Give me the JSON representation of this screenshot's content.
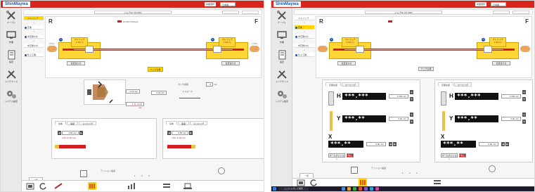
{
  "app": {
    "logo": "ShinMaywa",
    "lang_label": "言語選択",
    "lang_value": "日本語"
  },
  "shot_a": {
    "title": "ジョブNo.AN-0001",
    "sidebar": [
      "ケーブル",
      "作業",
      "設定",
      "メンテナンス",
      "システム設定"
    ],
    "steps": [
      "ストリップ",
      "圧着",
      "中芯整わせ",
      "中芯整わせ",
      "仕上工程"
    ],
    "left_letter": "R",
    "right_letter": "F",
    "left_strip": "ストリップ",
    "left_strip_val": "4.50mm",
    "right_strip": "ストリップ",
    "right_strip_val": "4.50mm",
    "pos_left": "位置合わせ",
    "pos_right": "位置合わせ",
    "mode_button": "ウェグ戻量",
    "side_labels": [
      "パネル",
      "パネル"
    ],
    "wire_info": "UL1007 AWG24",
    "center_values": [
      "1.41 mm",
      "0.10 mm",
      "1.41 +0.00 mm"
    ],
    "slider_label": "センサ感度",
    "slider_value": "0",
    "slider_unit": "mm",
    "counter_label": "ストローク",
    "tabs_left": [
      "基本",
      "速度",
      "トリミング"
    ],
    "tabs_right": [
      "基本",
      "速度",
      "トリミング"
    ],
    "strip_left_val": "4.50 mm",
    "strip_left_sub": "4.50 +0.00 mm",
    "strip_right_val": "4.50 mm",
    "strip_right_sub": "4.50 +0.00 mm",
    "bottom_label": "一覧",
    "speed_label": "テンション速度",
    "speed_scale": [
      "1",
      "2",
      "3"
    ]
  },
  "shot_b": {
    "title": "ジョブNo.AN-0001",
    "sidebar": [
      "ケーブル",
      "作業",
      "設定",
      "メンテナンス",
      "システム設定"
    ],
    "steps": [
      "ストリップ",
      "圧着",
      "中芯整わせ",
      "中芯整わせ",
      "仕上工程"
    ],
    "left_letter": "R",
    "right_letter": "F",
    "left_strip": "ストリップ",
    "left_strip_val": "4.50mm",
    "right_strip": "ストリップ",
    "right_strip_val": "4.50mm",
    "pos_left": "位置合わせ",
    "pos_right": "位置合わせ",
    "mode_button": "ウェグ戻量",
    "tabs_left": [
      "圧着位置",
      "ワーピング"
    ],
    "tabs_right": [
      "圧着位置",
      "ワーピング"
    ],
    "h_display": "***.***",
    "h_value": "2.000 mm",
    "y_display": "***.**",
    "y_value": "0.00 mm",
    "x_display": "***.**",
    "x_value": "0.00 mm",
    "reset_label": "ホームポジション",
    "stop_label": "停止",
    "bottom_label": "一覧",
    "speed_label": "テンション速度",
    "speed_scale": [
      "1",
      "2",
      "3"
    ],
    "taskbar_search": "ここに入力して検索"
  },
  "colors": {
    "brand_red": "#d9261c",
    "accent_yellow": "#ffd633",
    "wire_red": "#d21e1e",
    "badge_blue": "#1a55a8"
  }
}
